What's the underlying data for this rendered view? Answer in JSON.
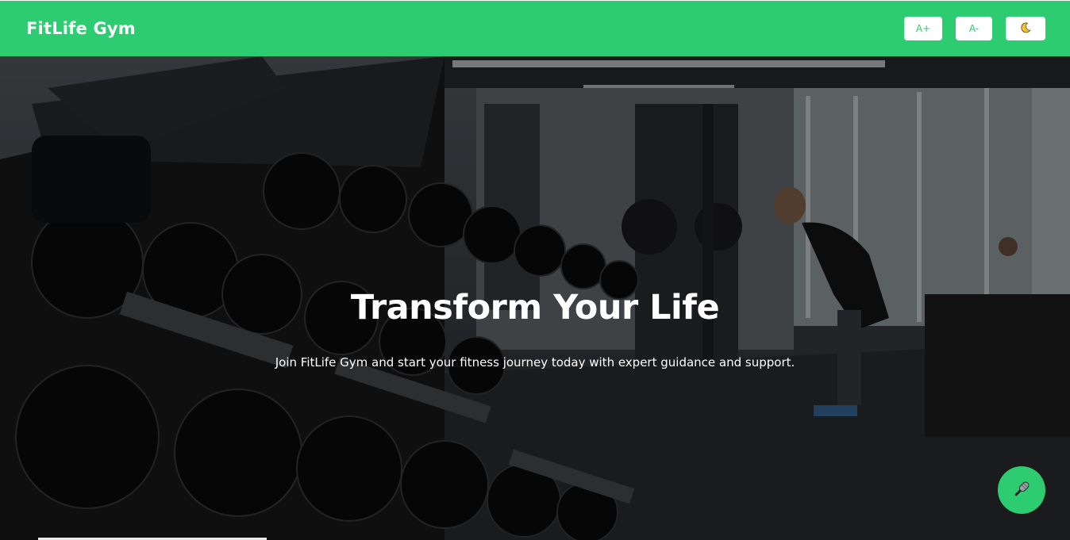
{
  "header": {
    "brand": "FitLife Gym",
    "controls": {
      "increase_font_label": "A+",
      "decrease_font_label": "A-",
      "theme_toggle_icon": "moon-icon"
    }
  },
  "hero": {
    "title": "Transform Your Life",
    "subtitle": "Join FitLife Gym and start your fitness journey today with expert guidance and support.",
    "background": "gym-dumbbell-rack-photo"
  },
  "floating": {
    "voice_button_icon": "microphone-icon"
  },
  "colors": {
    "accent": "#2ecc71",
    "header_text": "#ffffff",
    "hero_text": "#ffffff"
  }
}
